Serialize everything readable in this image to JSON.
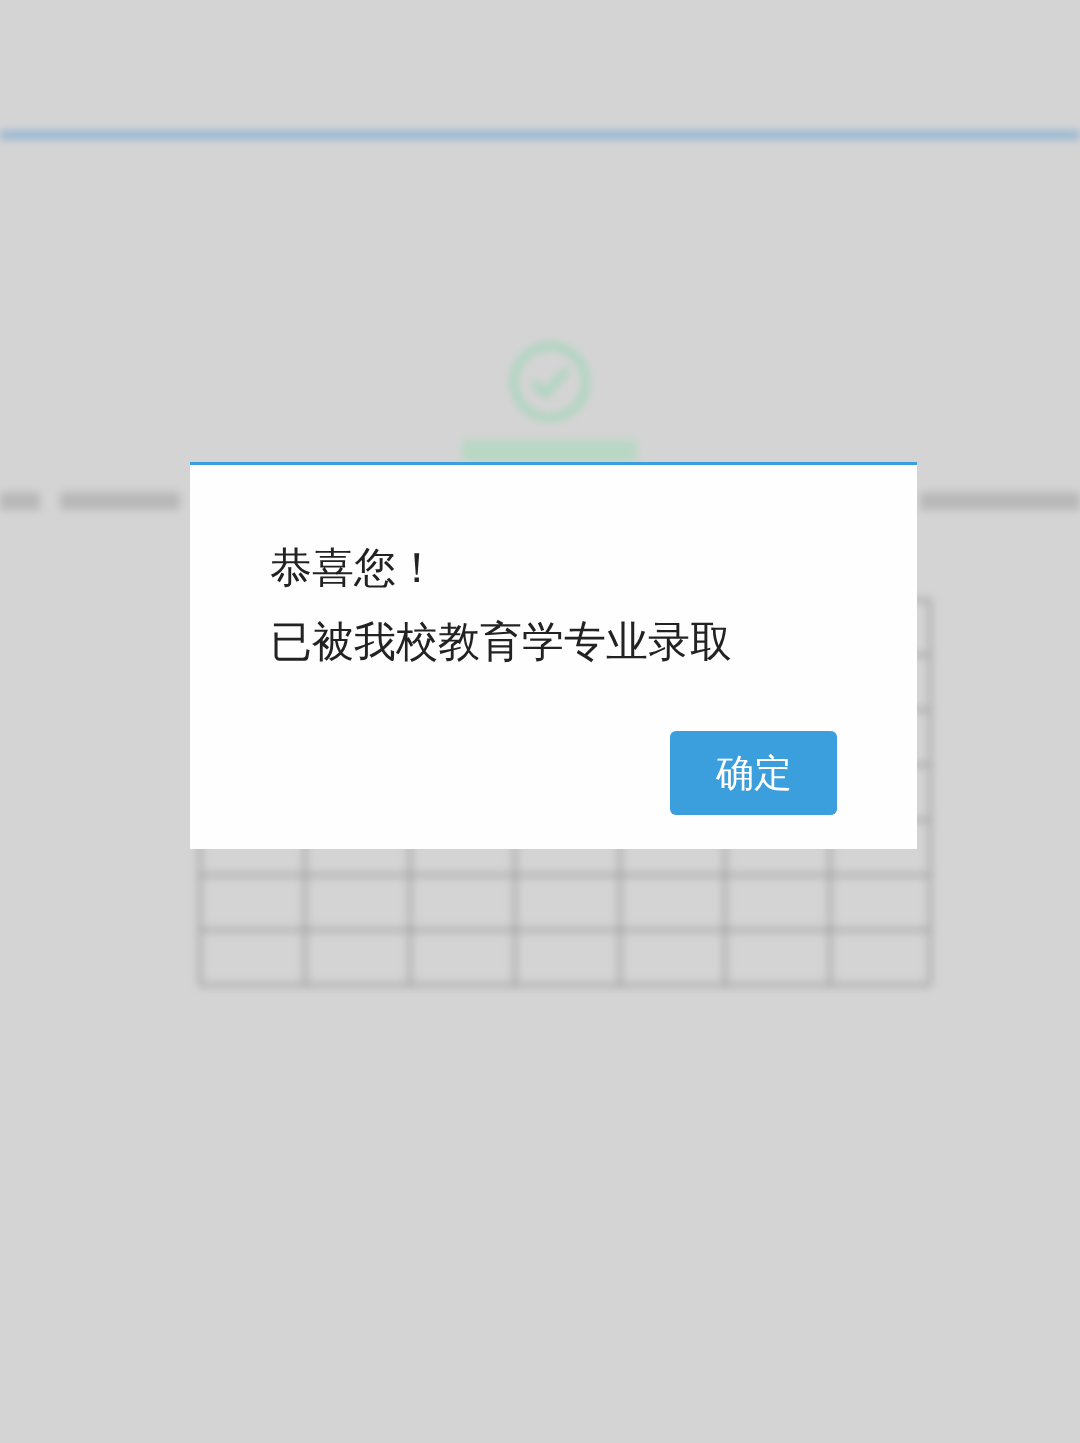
{
  "dialog": {
    "lines": [
      "恭喜您！",
      "已被我校教育学专业录取"
    ],
    "confirm_button": "确定"
  }
}
